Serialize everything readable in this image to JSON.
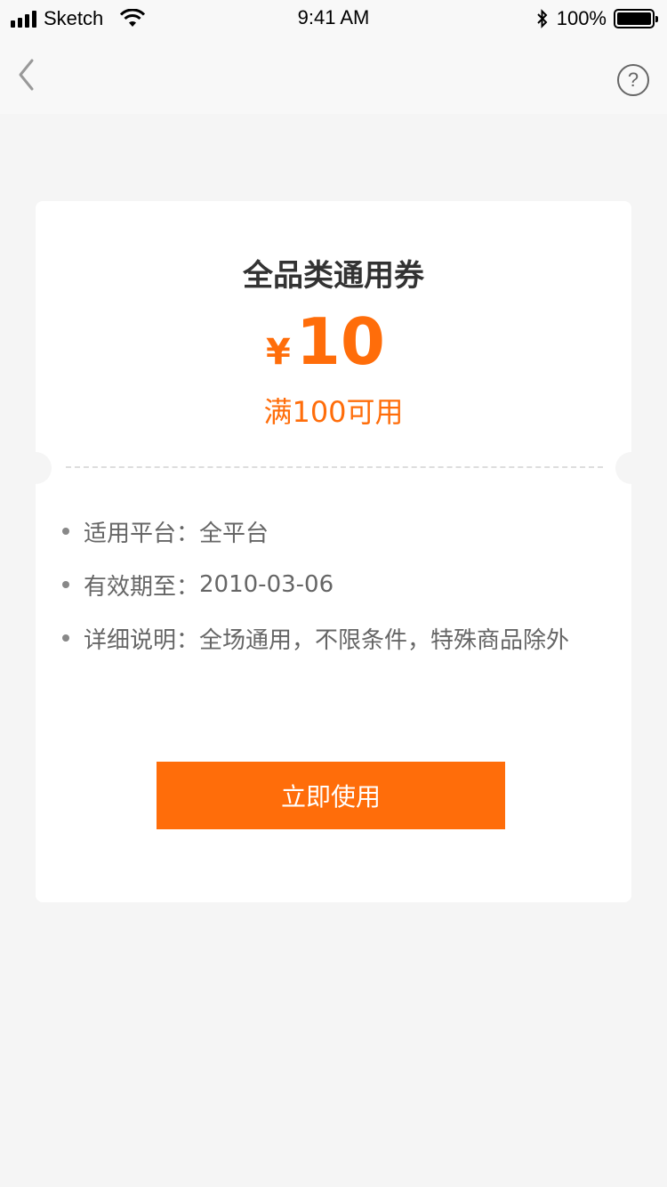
{
  "status_bar": {
    "carrier": "Sketch",
    "time": "9:41 AM",
    "battery": "100%",
    "battery_level": 1.0,
    "icons": [
      "signal-icon",
      "wifi-icon",
      "bluetooth-icon",
      "battery-icon"
    ]
  },
  "nav": {
    "back_icon": "chevron-left-icon",
    "help_label": "?",
    "help_icon": "help-circle-icon"
  },
  "coupon": {
    "title": "全品类通用券",
    "currency": "¥",
    "amount": "10",
    "condition": "满100可用",
    "info": [
      {
        "label": "适用平台：",
        "value": "全平台"
      },
      {
        "label": "有效期至：",
        "value": "2010-03-06"
      },
      {
        "label": "详细说明：",
        "value": "全场通用，不限条件，特殊商品除外"
      }
    ],
    "use_button_label": "立即使用"
  },
  "colors": {
    "accent": "#ff6d0a",
    "background": "#f5f5f5",
    "card": "#ffffff",
    "text_primary": "#333333",
    "text_secondary": "#666666"
  }
}
